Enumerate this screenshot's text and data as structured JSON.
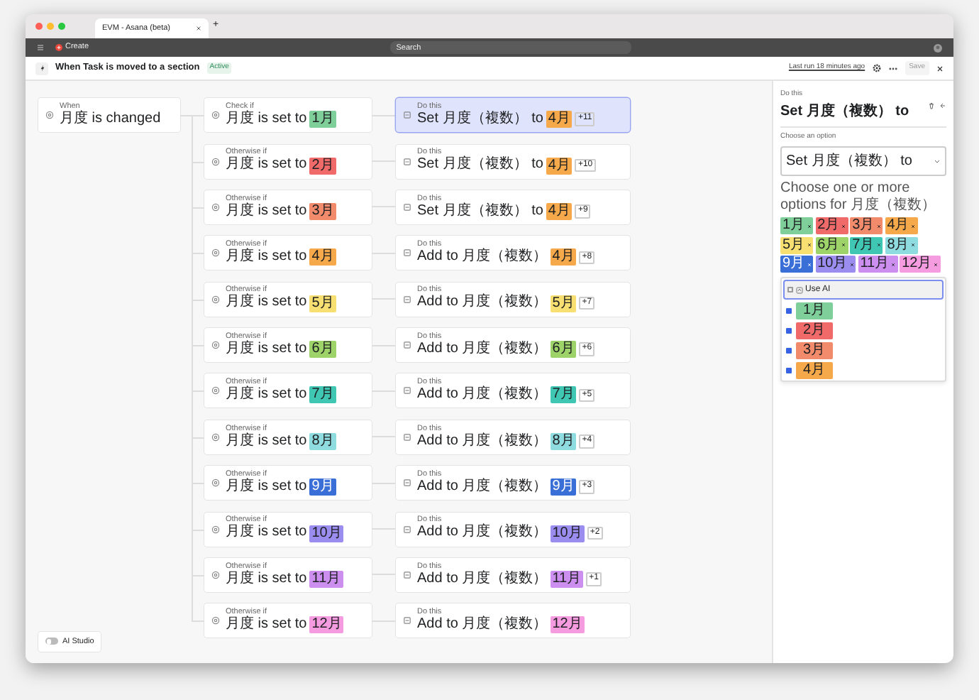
{
  "browser": {
    "tab_title": "EVM - Asana (beta)",
    "new_tab": "+",
    "create": "Create",
    "search_placeholder": "Search"
  },
  "header": {
    "title": "When Task is moved to a section",
    "status": "Active",
    "last_run": "Last run 18 minutes ago",
    "save": "Save"
  },
  "trigger": {
    "label": "When",
    "text": "月度 is changed"
  },
  "branches": [
    {
      "condition": {
        "label": "Check if",
        "text": "月度 is set to",
        "value": "1月",
        "color": "#7fcf9a"
      },
      "action": {
        "label": "Do this",
        "text": "Set 月度（複数） to",
        "value": "4月",
        "color": "#f5a94a",
        "more": "+11",
        "selected": true
      }
    },
    {
      "condition": {
        "label": "Otherwise if",
        "text": "月度 is set to",
        "value": "2月",
        "color": "#f06a6a"
      },
      "action": {
        "label": "Do this",
        "text": "Set 月度（複数） to",
        "value": "4月",
        "color": "#f5a94a",
        "more": "+10",
        "selected": false
      }
    },
    {
      "condition": {
        "label": "Otherwise if",
        "text": "月度 is set to",
        "value": "3月",
        "color": "#f28b6c"
      },
      "action": {
        "label": "Do this",
        "text": "Set 月度（複数） to",
        "value": "4月",
        "color": "#f5a94a",
        "more": "+9",
        "selected": false
      }
    },
    {
      "condition": {
        "label": "Otherwise if",
        "text": "月度 is set to",
        "value": "4月",
        "color": "#f5a94a"
      },
      "action": {
        "label": "Do this",
        "text": "Add to 月度（複数）",
        "value": "4月",
        "color": "#f5a94a",
        "more": "+8",
        "selected": false
      }
    },
    {
      "condition": {
        "label": "Otherwise if",
        "text": "月度 is set to",
        "value": "5月",
        "color": "#f8df72"
      },
      "action": {
        "label": "Do this",
        "text": "Add to 月度（複数）",
        "value": "5月",
        "color": "#f8df72",
        "more": "+7",
        "selected": false
      }
    },
    {
      "condition": {
        "label": "Otherwise if",
        "text": "月度 is set to",
        "value": "6月",
        "color": "#9ed36a"
      },
      "action": {
        "label": "Do this",
        "text": "Add to 月度（複数）",
        "value": "6月",
        "color": "#9ed36a",
        "more": "+6",
        "selected": false
      }
    },
    {
      "condition": {
        "label": "Otherwise if",
        "text": "月度 is set to",
        "value": "7月",
        "color": "#3fc7b4"
      },
      "action": {
        "label": "Do this",
        "text": "Add to 月度（複数）",
        "value": "7月",
        "color": "#3fc7b4",
        "more": "+5",
        "selected": false
      }
    },
    {
      "condition": {
        "label": "Otherwise if",
        "text": "月度 is set to",
        "value": "8月",
        "color": "#8fdce0"
      },
      "action": {
        "label": "Do this",
        "text": "Add to 月度（複数）",
        "value": "8月",
        "color": "#8fdce0",
        "more": "+4",
        "selected": false
      }
    },
    {
      "condition": {
        "label": "Otherwise if",
        "text": "月度 is set to",
        "value": "9月",
        "color": "#3b6fd8"
      },
      "action": {
        "label": "Do this",
        "text": "Add to 月度（複数）",
        "value": "9月",
        "color": "#3b6fd8",
        "more": "+3",
        "selected": false
      }
    },
    {
      "condition": {
        "label": "Otherwise if",
        "text": "月度 is set to",
        "value": "10月",
        "color": "#9b8cf0"
      },
      "action": {
        "label": "Do this",
        "text": "Add to 月度（複数）",
        "value": "10月",
        "color": "#9b8cf0",
        "more": "+2",
        "selected": false
      }
    },
    {
      "condition": {
        "label": "Otherwise if",
        "text": "月度 is set to",
        "value": "11月",
        "color": "#cc8ff0"
      },
      "action": {
        "label": "Do this",
        "text": "Add to 月度（複数）",
        "value": "11月",
        "color": "#cc8ff0",
        "more": "+1",
        "selected": false
      }
    },
    {
      "condition": {
        "label": "Otherwise if",
        "text": "月度 is set to",
        "value": "12月",
        "color": "#f59be0"
      },
      "action": {
        "label": "Do this",
        "text": "Add to 月度（複数）",
        "value": "12月",
        "color": "#f59be0",
        "selected": false
      }
    }
  ],
  "panel": {
    "section": "Do this",
    "title": "Set 月度（複数） to",
    "choose_label": "Choose an option",
    "choose_value": "Set 月度（複数） to",
    "options_label": "Choose one or more options for 月度（複数）",
    "tags": [
      {
        "text": "1月",
        "color": "#7fcf9a"
      },
      {
        "text": "2月",
        "color": "#f06a6a"
      },
      {
        "text": "3月",
        "color": "#f28b6c"
      },
      {
        "text": "4月",
        "color": "#f5a94a"
      },
      {
        "text": "5月",
        "color": "#f8df72"
      },
      {
        "text": "6月",
        "color": "#9ed36a"
      },
      {
        "text": "7月",
        "color": "#3fc7b4"
      },
      {
        "text": "8月",
        "color": "#8fdce0"
      },
      {
        "text": "9月",
        "color": "#3b6fd8"
      },
      {
        "text": "10月",
        "color": "#9b8cf0"
      },
      {
        "text": "11月",
        "color": "#cc8ff0"
      },
      {
        "text": "12月",
        "color": "#f59be0"
      }
    ],
    "use_ai": {
      "text": "Use AI",
      "checked": false
    },
    "options": [
      {
        "text": "1月",
        "color": "#7fcf9a",
        "checked": true
      },
      {
        "text": "2月",
        "color": "#f06a6a",
        "checked": true
      },
      {
        "text": "3月",
        "color": "#f28b6c",
        "checked": true
      },
      {
        "text": "4月",
        "color": "#f5a94a",
        "checked": true
      }
    ]
  },
  "ai_studio": {
    "label": "AI Studio",
    "on": false
  }
}
